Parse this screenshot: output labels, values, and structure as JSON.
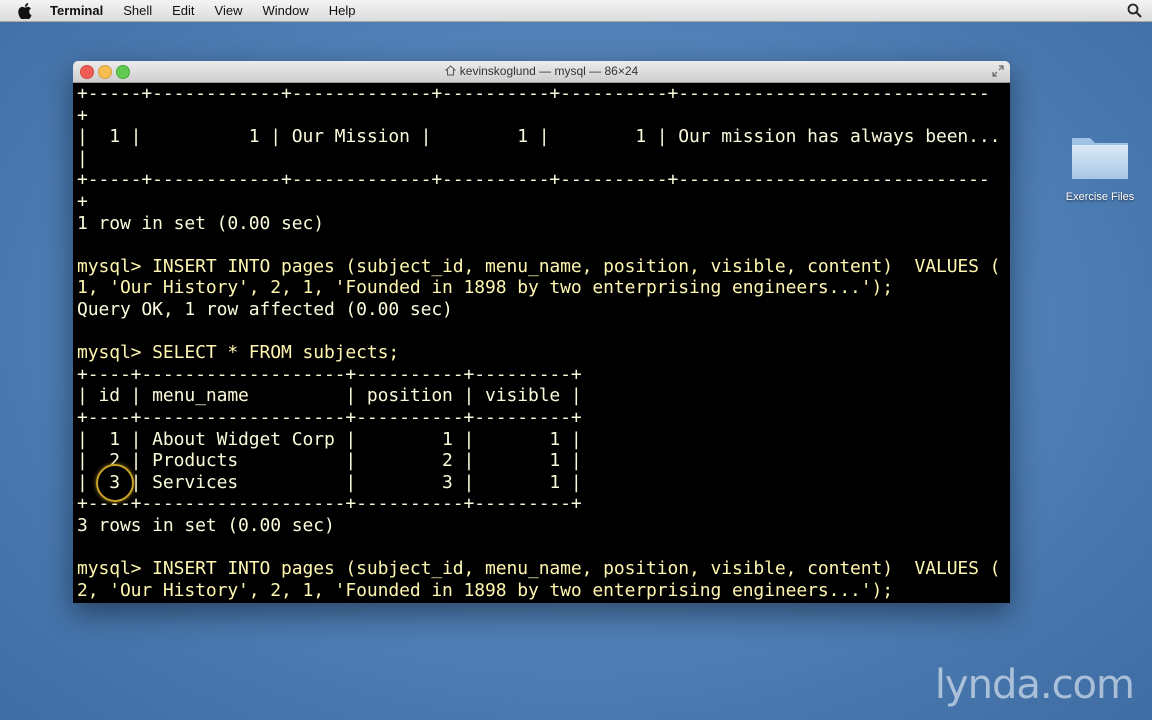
{
  "menubar": {
    "app_name": "Terminal",
    "items": [
      "Shell",
      "Edit",
      "View",
      "Window",
      "Help"
    ]
  },
  "desktop": {
    "folder_label": "Exercise Files"
  },
  "window": {
    "title": "kevinskoglund — mysql — 86×24"
  },
  "terminal": {
    "lines": [
      "+-----+------------+-------------+----------+----------+-----------------------------",
      "+",
      "|  1 |          1 | Our Mission |        1 |        1 | Our mission has always been...",
      "|",
      "+-----+------------+-------------+----------+----------+-----------------------------",
      "+",
      "1 row in set (0.00 sec)",
      "",
      "mysql> INSERT INTO pages (subject_id, menu_name, position, visible, content)  VALUES (",
      "1, 'Our History', 2, 1, 'Founded in 1898 by two enterprising engineers...');",
      "Query OK, 1 row affected (0.00 sec)",
      "",
      "mysql> SELECT * FROM subjects;",
      "+----+-------------------+----------+---------+",
      "| id | menu_name         | position | visible |",
      "+----+-------------------+----------+---------+",
      "|  1 | About Widget Corp |        1 |       1 |",
      "|  2 | Products          |        2 |       1 |",
      "|  3 | Services          |        3 |       1 |",
      "+----+-------------------+----------+---------+",
      "3 rows in set (0.00 sec)",
      "",
      "mysql> INSERT INTO pages (subject_id, menu_name, position, visible, content)  VALUES (",
      "2, 'Our History', 2, 1, 'Founded in 1898 by two enterprising engineers...');"
    ]
  },
  "watermark": "lynda.com"
}
